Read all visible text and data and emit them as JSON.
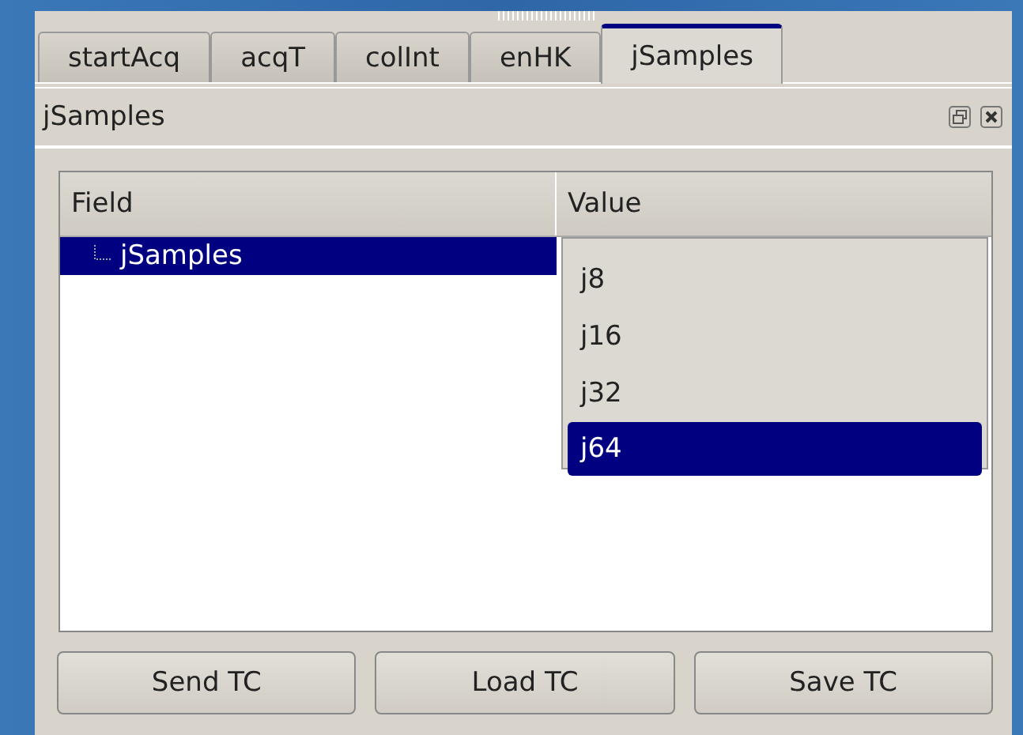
{
  "tabs": [
    {
      "label": "startAcq",
      "selected": false
    },
    {
      "label": "acqT",
      "selected": false
    },
    {
      "label": "colInt",
      "selected": false
    },
    {
      "label": "enHK",
      "selected": false
    },
    {
      "label": "jSamples",
      "selected": true
    }
  ],
  "dock": {
    "title": "jSamples"
  },
  "tree": {
    "columns": [
      "Field",
      "Value"
    ],
    "rows": [
      {
        "field": "jSamples",
        "selected": true
      }
    ]
  },
  "dropdown": {
    "options": [
      {
        "label": "j8",
        "selected": false
      },
      {
        "label": "j16",
        "selected": false
      },
      {
        "label": "j32",
        "selected": false
      },
      {
        "label": "j64",
        "selected": true
      }
    ]
  },
  "buttons": [
    "Send TC",
    "Load TC",
    "Save TC"
  ]
}
